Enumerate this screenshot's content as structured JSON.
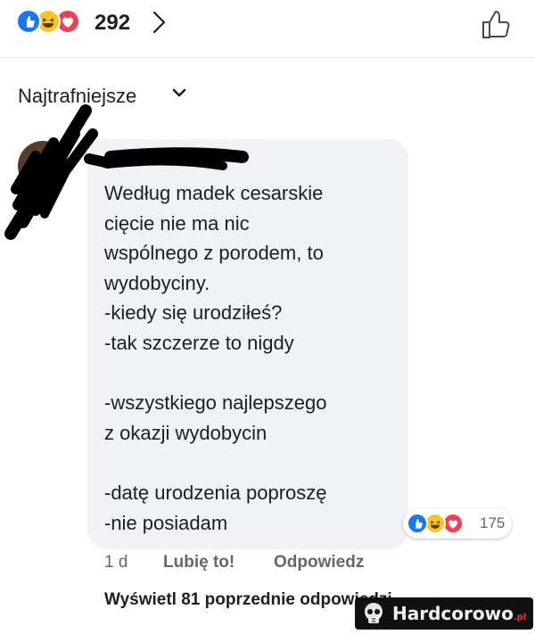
{
  "post": {
    "reaction_count": "292",
    "reactions": [
      "like-icon",
      "haha-icon",
      "love-icon"
    ]
  },
  "comments_sort": {
    "label": "Najtrafniejsze"
  },
  "comment": {
    "author": "",
    "text": "Według madek cesarskie\ncięcie nie ma nic\nwspólnego z porodem, to\nwydobyciny.\n-kiedy się urodziłeś?\n-tak szczerze to nigdy\n\n-wszystkiego najlepszego\nz okazji wydobycin\n\n-datę urodzenia poproszę\n-nie posiadam",
    "reaction_count": "175",
    "time": "1 d",
    "like_label": "Lubię to!",
    "reply_label": "Odpowiedz"
  },
  "view_previous": "Wyświetl 81 poprzednie odpowiedzi",
  "watermark": {
    "text": "Hardcorowo",
    "suffix": ".pl"
  },
  "colors": {
    "like": "#1877f2",
    "haha": "#f7c624",
    "love": "#f33e58",
    "bubble": "#f0f2f5",
    "secondary_text": "#65676b"
  }
}
